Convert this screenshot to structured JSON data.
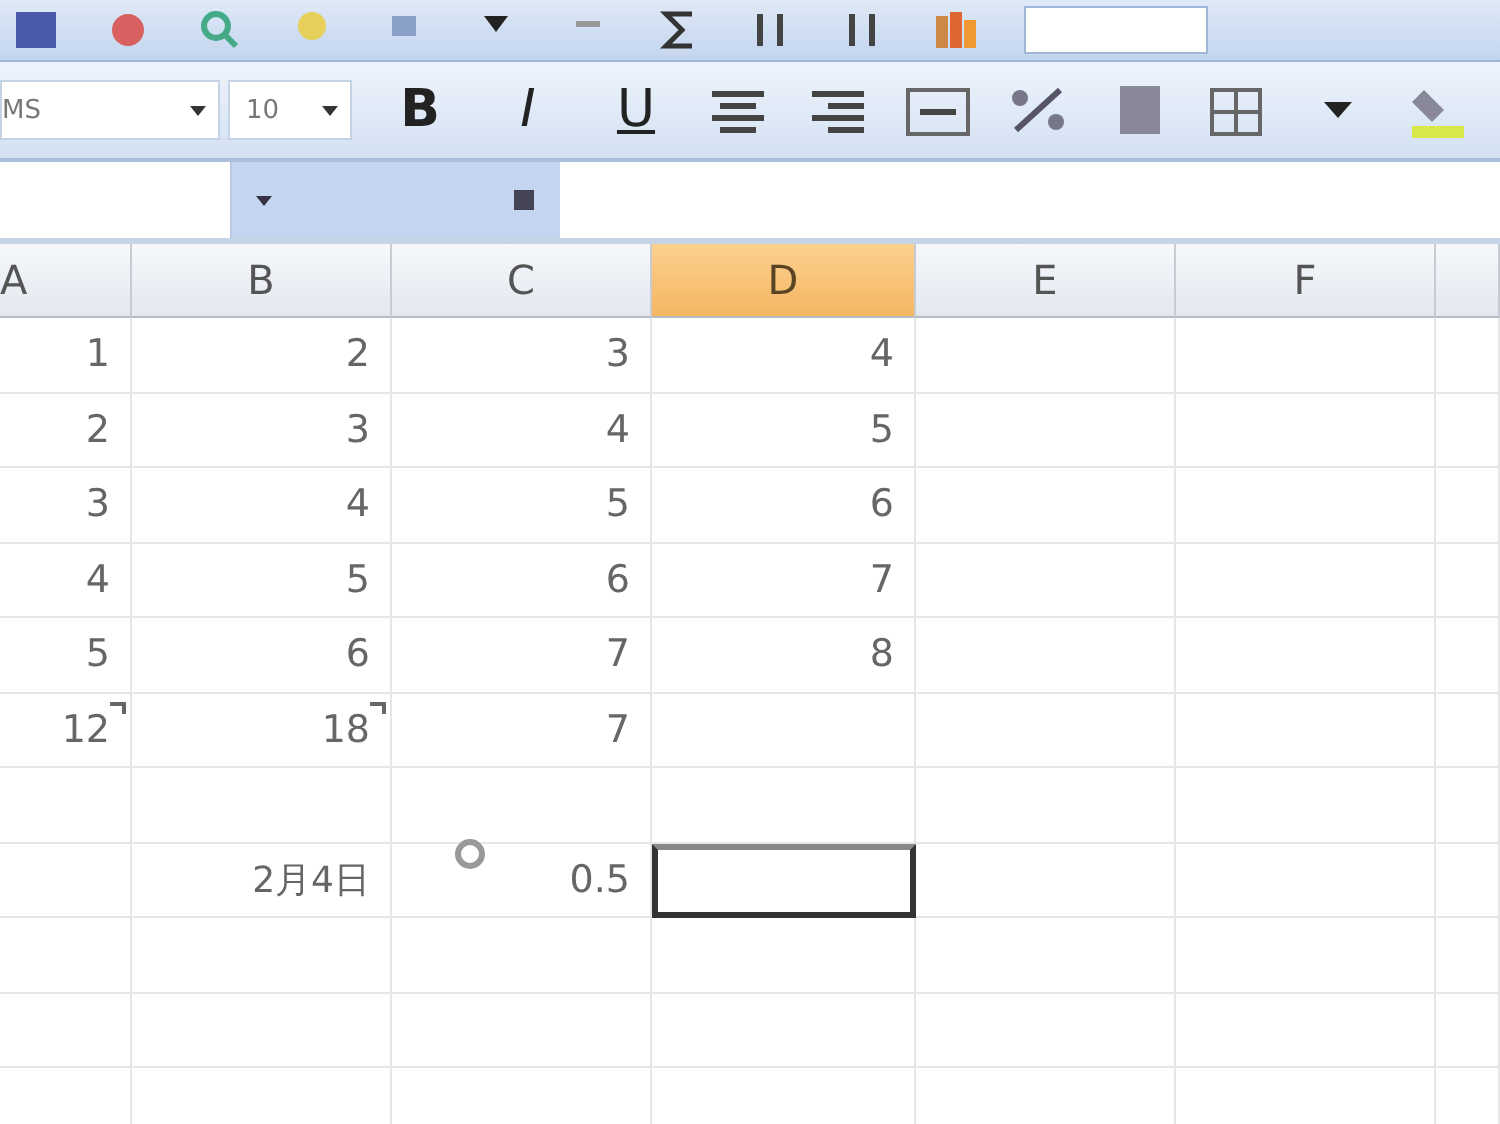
{
  "format_toolbar": {
    "font": "MS",
    "size": "10",
    "buttons": [
      {
        "kind": "bold",
        "label": "B"
      },
      {
        "kind": "italic",
        "label": "I"
      },
      {
        "kind": "underline",
        "label": "U"
      }
    ]
  },
  "columns": [
    {
      "label": "A",
      "selected": false
    },
    {
      "label": "B",
      "selected": false
    },
    {
      "label": "C",
      "selected": false
    },
    {
      "label": "D",
      "selected": true
    },
    {
      "label": "E",
      "selected": false
    },
    {
      "label": "F",
      "selected": false
    }
  ],
  "rows": [
    {
      "cells": [
        {
          "value": "1"
        },
        {
          "value": "2"
        },
        {
          "value": "3"
        },
        {
          "value": "4"
        },
        {},
        {}
      ]
    },
    {
      "cells": [
        {
          "value": "2"
        },
        {
          "value": "3"
        },
        {
          "value": "4"
        },
        {
          "value": "5"
        },
        {},
        {}
      ]
    },
    {
      "cells": [
        {
          "value": "3"
        },
        {
          "value": "4"
        },
        {
          "value": "5"
        },
        {
          "value": "6"
        },
        {},
        {}
      ]
    },
    {
      "cells": [
        {
          "value": "4"
        },
        {
          "value": "5"
        },
        {
          "value": "6"
        },
        {
          "value": "7"
        },
        {},
        {}
      ]
    },
    {
      "cells": [
        {
          "value": "5"
        },
        {
          "value": "6"
        },
        {
          "value": "7"
        },
        {
          "value": "8"
        },
        {},
        {}
      ]
    },
    {
      "cells": [
        {
          "value": "12",
          "error": true
        },
        {
          "value": "18",
          "error": true
        },
        {
          "value": "7"
        },
        {},
        {},
        {}
      ]
    },
    {
      "cells": [
        {},
        {},
        {},
        {},
        {},
        {}
      ]
    },
    {
      "cells": [
        {},
        {
          "value": "2月4日"
        },
        {
          "value": "0.5",
          "smart_tag": true
        },
        {
          "selected": true
        },
        {},
        {}
      ]
    },
    {
      "cells": [
        {},
        {},
        {},
        {},
        {},
        {}
      ]
    },
    {
      "cells": [
        {},
        {},
        {},
        {},
        {},
        {}
      ]
    },
    {
      "cells": [
        {},
        {},
        {},
        {},
        {},
        {}
      ]
    }
  ]
}
